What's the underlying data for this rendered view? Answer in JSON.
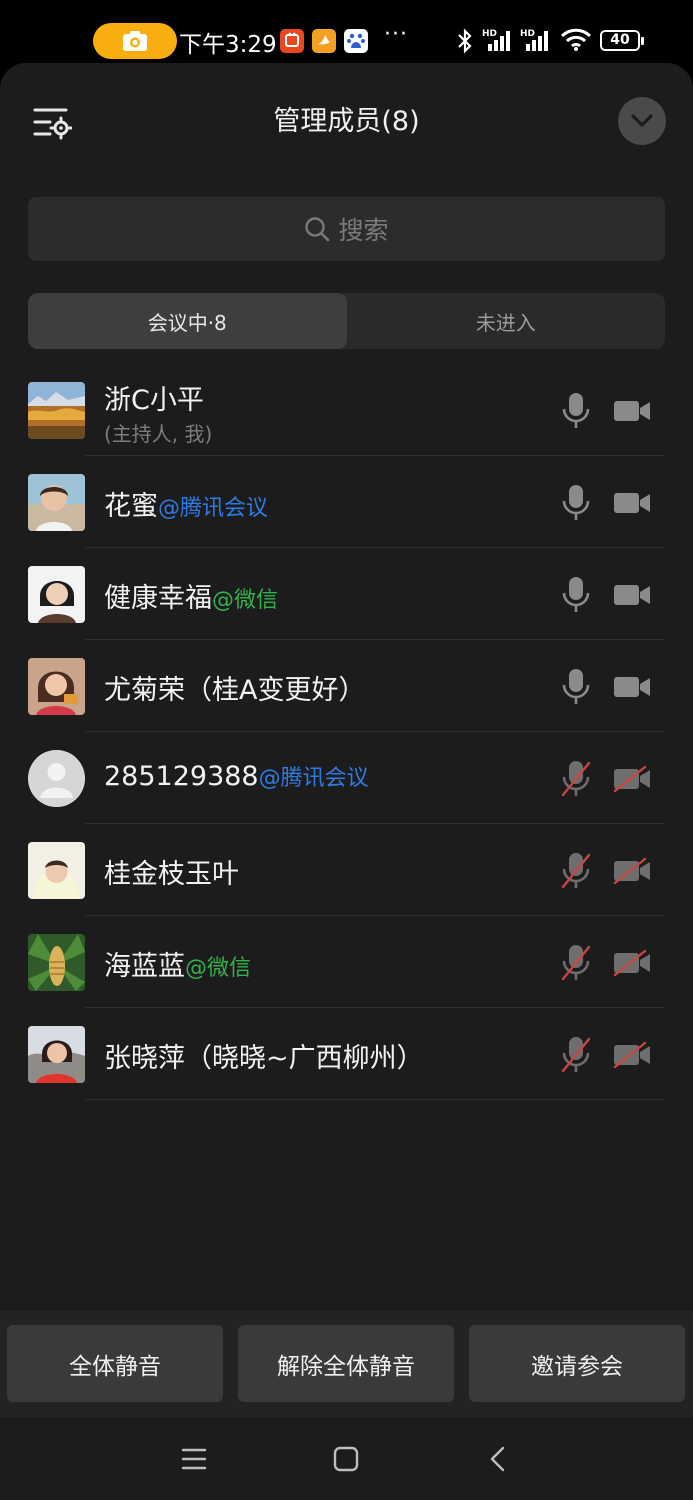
{
  "status_bar": {
    "time": "下午3:29",
    "more": "···",
    "battery": "40"
  },
  "header": {
    "title": "管理成员(8)"
  },
  "search": {
    "placeholder": "搜索"
  },
  "tabs": [
    {
      "label": "会议中·8",
      "active": true
    },
    {
      "label": "未进入",
      "active": false
    }
  ],
  "members": [
    {
      "name": "浙C小平",
      "tag": "",
      "sub": "(主持人, 我)",
      "mic": "on",
      "camera": "on"
    },
    {
      "name": "花蜜",
      "tag": "@腾讯会议",
      "sub": "",
      "mic": "on",
      "camera": "on"
    },
    {
      "name": "健康幸福",
      "tag": "@微信",
      "sub": "",
      "mic": "on",
      "camera": "on"
    },
    {
      "name": "尤菊荣（桂A变更好）",
      "tag": "",
      "sub": "",
      "mic": "on",
      "camera": "on"
    },
    {
      "name": "285129388",
      "tag": "@腾讯会议",
      "sub": "",
      "mic": "muted",
      "camera": "off"
    },
    {
      "name": "桂金枝玉叶",
      "tag": "",
      "sub": "",
      "mic": "muted",
      "camera": "off"
    },
    {
      "name": "海蓝蓝",
      "tag": "@微信",
      "sub": "",
      "mic": "muted",
      "camera": "off"
    },
    {
      "name": "张晓萍（晓晓~广西柳州）",
      "tag": "",
      "sub": "",
      "mic": "muted",
      "camera": "off"
    }
  ],
  "actions": {
    "mute_all": "全体静音",
    "unmute_all": "解除全体静音",
    "invite": "邀请参会"
  },
  "colors": {
    "accent_blue": "#2f7be6",
    "accent_green": "#31b24c",
    "muted_red": "#c8463e",
    "status_pill": "#f9ae10"
  }
}
